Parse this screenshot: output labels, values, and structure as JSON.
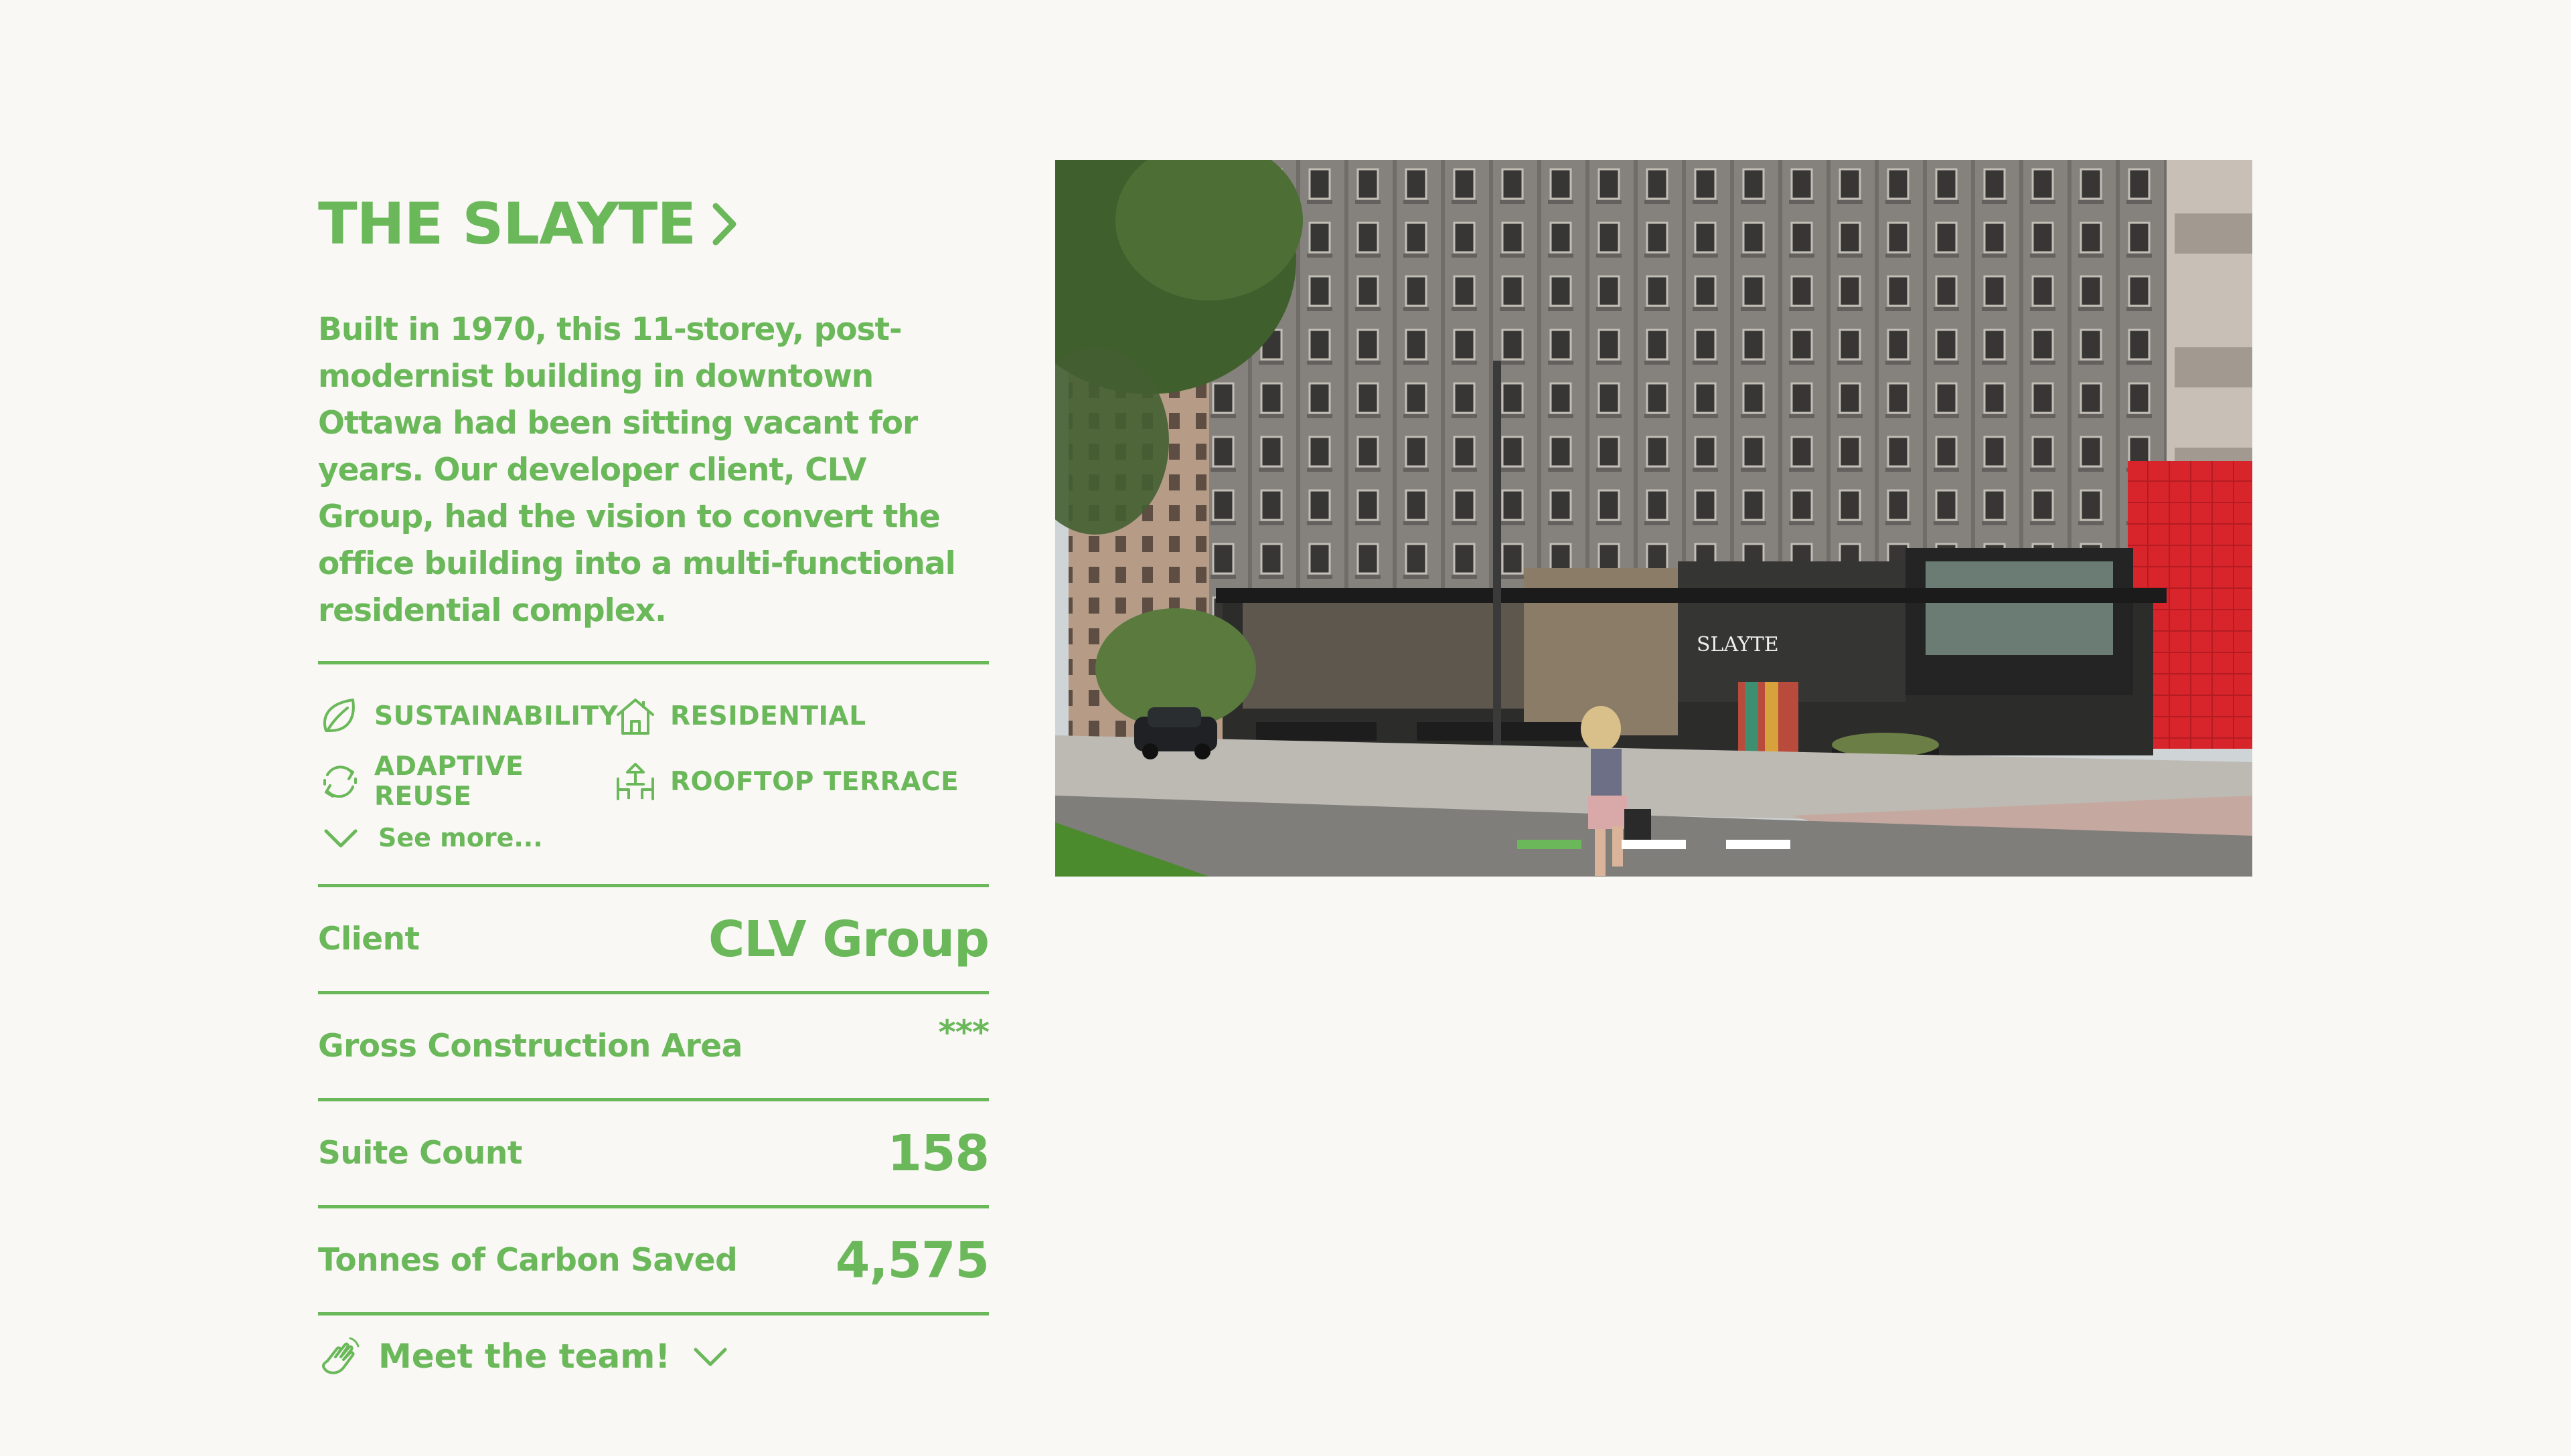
{
  "project": {
    "title": "THE SLAYTE",
    "description": "Built in 1970, this 11-storey, post-modernist building in downtown Ottawa had been sitting vacant for years. Our developer client, CLV Group, had the vision to convert the office building into a multi-functional residential complex."
  },
  "tags": [
    {
      "label": "SUSTAINABILITY",
      "icon": "leaf-icon"
    },
    {
      "label": "RESIDENTIAL",
      "icon": "house-icon"
    },
    {
      "label": "ADAPTIVE REUSE",
      "icon": "recycle-icon"
    },
    {
      "label": "ROOFTOP TERRACE",
      "icon": "terrace-icon"
    }
  ],
  "see_more": "See more...",
  "stats": [
    {
      "label": "Client",
      "value": "CLV Group"
    },
    {
      "label": "Gross Construction Area",
      "value": "***"
    },
    {
      "label": "Suite Count",
      "value": "158"
    },
    {
      "label": "Tonnes of Carbon Saved",
      "value": "4,575"
    }
  ],
  "team_button": "Meet the team!",
  "carousel": {
    "slide_count": 3,
    "active_index": 0,
    "building_sign": "SLAYTE"
  },
  "colors": {
    "accent": "#6ab85a",
    "background": "#f9f8f4"
  }
}
